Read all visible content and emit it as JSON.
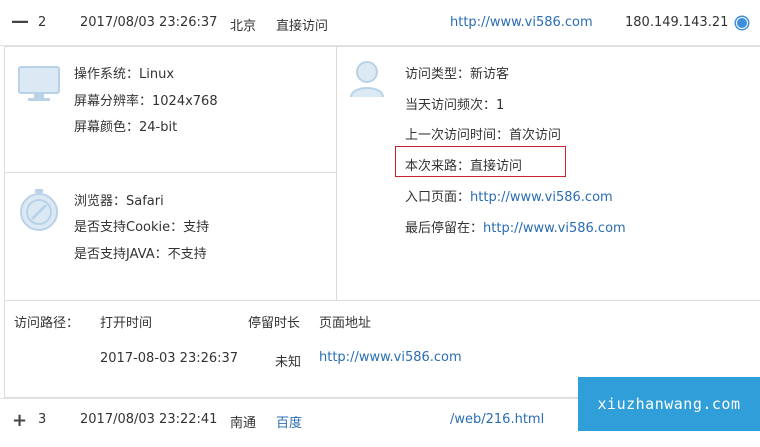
{
  "row1": {
    "expander": "—",
    "index": "2",
    "datetime": "2017/08/03 23:26:37",
    "city": "北京",
    "source": "直接访问",
    "url": "http://www.vi586.com",
    "ip": "180.149.143.21",
    "browser_icon": "safari-compass-icon"
  },
  "system": {
    "icon": "monitor-icon",
    "os": "操作系统：Linux",
    "resolution": "屏幕分辨率：1024x768",
    "color": "屏幕颜色：24-bit"
  },
  "browser": {
    "icon": "compass-icon",
    "name": "浏览器：Safari",
    "cookie": "是否支持Cookie：支持",
    "java": "是否支持JAVA：不支持"
  },
  "visitor": {
    "icon": "user-icon",
    "type": "访问类型：新访客",
    "daily_freq": "当天访问频次：1",
    "last_visit": "上一次访问时间：首次访问",
    "source_label": "本次来路：直接访问",
    "entry_label": "入口页面：",
    "entry_url": "http://www.vi586.com",
    "last_stay_label": "最后停留在：",
    "last_stay_url": "http://www.vi586.com"
  },
  "path": {
    "label": "访问路径：",
    "col_open": "打开时间",
    "col_stay": "停留时长",
    "col_url": "页面地址",
    "row_time": "2017-08-03 23:26:37",
    "row_stay": "未知",
    "row_url": "http://www.vi586.com"
  },
  "row2": {
    "expander": "+",
    "index": "3",
    "datetime": "2017/08/03 23:22:41",
    "city": "南通",
    "source": "百度",
    "url": "/web/216.html"
  },
  "watermark": "xiuzhanwang.com",
  "colors": {
    "link": "#2a6db3",
    "highlight": "#c9242b",
    "watermark_bg": "#2f9ed9"
  }
}
